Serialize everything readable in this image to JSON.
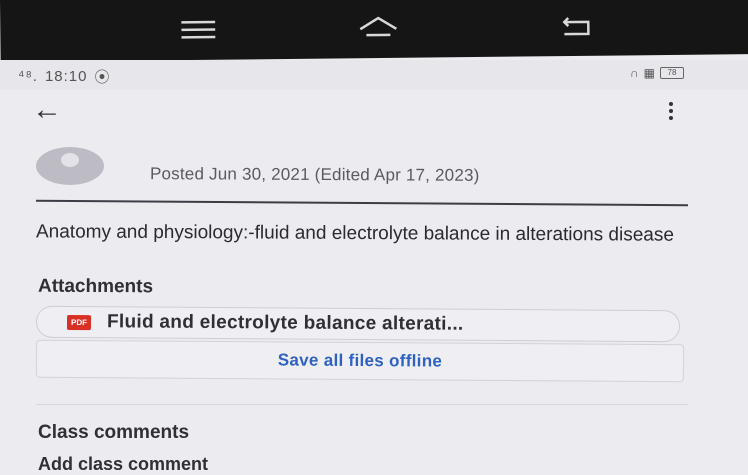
{
  "status_bar": {
    "network": "⁴⁸.",
    "time": "18:10",
    "battery": "78"
  },
  "post": {
    "posted_text": "Posted Jun 30, 2021 (Edited Apr 17, 2023)",
    "title": "Anatomy and physiology:-fluid and electrolyte balance in alterations disease"
  },
  "attachments": {
    "heading": "Attachments",
    "file_name": "Fluid and electrolyte balance alterati...",
    "file_badge": "PDF",
    "save_all_label": "Save all files offline"
  },
  "comments": {
    "heading": "Class comments",
    "add_label": "Add class comment"
  },
  "colors": {
    "accent": "#2e62c0",
    "pdf": "#d93025",
    "nav_bar": "#151515",
    "background": "#ecebf0"
  },
  "icons": [
    "menu-icon",
    "home-icon",
    "back-nav-icon",
    "back-arrow-icon",
    "more-vert-icon",
    "avatar-icon",
    "pdf-icon"
  ]
}
